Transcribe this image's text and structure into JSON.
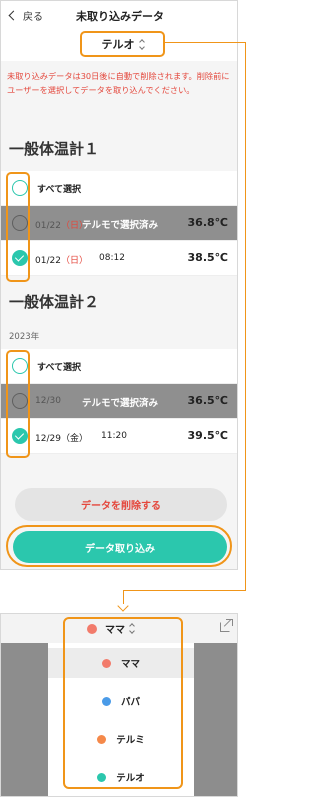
{
  "header": {
    "back_label": "戻る",
    "title": "未取り込みデータ"
  },
  "device_selector": {
    "value": "テルオ"
  },
  "notice": "未取り込みデータは30日後に自動で削除されます。削除前にユーザーを選択してデータを取り込んでください。",
  "sections": [
    {
      "title": "一般体温計１",
      "year": "",
      "select_all_label": "すべて選択",
      "rows": [
        {
          "date": "01/22",
          "dow": "（日）",
          "time": "",
          "status": "テルモで選択済み",
          "temp": "36.8℃",
          "checked": false,
          "imported_by_other": true
        },
        {
          "date": "01/22",
          "dow": "（日）",
          "time": "08:12",
          "status": "",
          "temp": "38.5℃",
          "checked": true,
          "imported_by_other": false
        }
      ]
    },
    {
      "title": "一般体温計２",
      "year": "2023年",
      "select_all_label": "すべて選択",
      "rows": [
        {
          "date": "12/30",
          "dow": "",
          "time": "",
          "status": "テルモで選択済み",
          "temp": "36.5℃",
          "checked": false,
          "imported_by_other": true
        },
        {
          "date": "12/29",
          "dow": "（金）",
          "time": "11:20",
          "status": "",
          "temp": "39.5℃",
          "checked": true,
          "imported_by_other": false
        }
      ]
    }
  ],
  "buttons": {
    "delete_label": "データを削除する",
    "import_label": "データ取り込み"
  },
  "user_picker": {
    "selected": {
      "name": "ママ",
      "color": "#f27b6b"
    },
    "options": [
      {
        "name": "ママ",
        "color": "#f27b6b"
      },
      {
        "name": "パパ",
        "color": "#4a9be8"
      },
      {
        "name": "テルミ",
        "color": "#f5894a"
      },
      {
        "name": "テルオ",
        "color": "#2bc7ad"
      }
    ]
  },
  "colors": {
    "accent": "#2bc7ad",
    "warning": "#e4473c",
    "highlight": "#f09519"
  },
  "icons": {
    "back": "chevron-left-icon",
    "updown": "updown-chevron-icon",
    "external": "external-link-icon",
    "check": "check-icon"
  }
}
